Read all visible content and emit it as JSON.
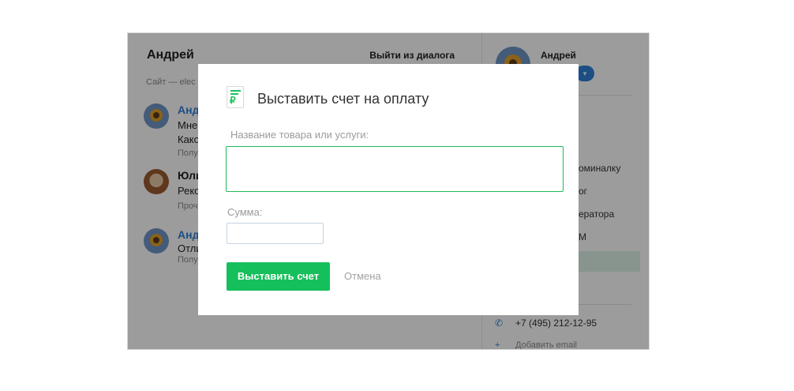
{
  "chat": {
    "title": "Андрей",
    "leave_label": "Выйти из диалога",
    "site_line": "Сайт — elec",
    "messages": [
      {
        "author": "Анд",
        "lines": [
          "Мне",
          "Како"
        ],
        "meta": "Полу"
      },
      {
        "author": "Юли",
        "lines": [
          "Реко"
        ],
        "meta": "Проч"
      },
      {
        "author": "Анд",
        "lines": [
          "Отли"
        ],
        "meta": "Полу"
      }
    ],
    "name_color": "#2f7fd6"
  },
  "sidebar": {
    "name": "Андрей",
    "dropdown_icon": "chevron-down-icon",
    "items": [
      "оминалку",
      "ог",
      "ератора",
      "М"
    ],
    "phone": "+7 (495) 212-12-95",
    "phone_icon": "phone-icon",
    "add_email": "Добавить email",
    "add_icon": "plus-icon"
  },
  "modal": {
    "icon": "invoice-ruble-icon",
    "icon_glyph": "₽",
    "title": "Выставить счет на оплату",
    "name_label": "Название товара или услуги:",
    "name_value": "",
    "sum_label": "Сумма:",
    "sum_value": "",
    "submit_label": "Выставить счет",
    "cancel_label": "Отмена",
    "accent": "#15bf5b"
  }
}
